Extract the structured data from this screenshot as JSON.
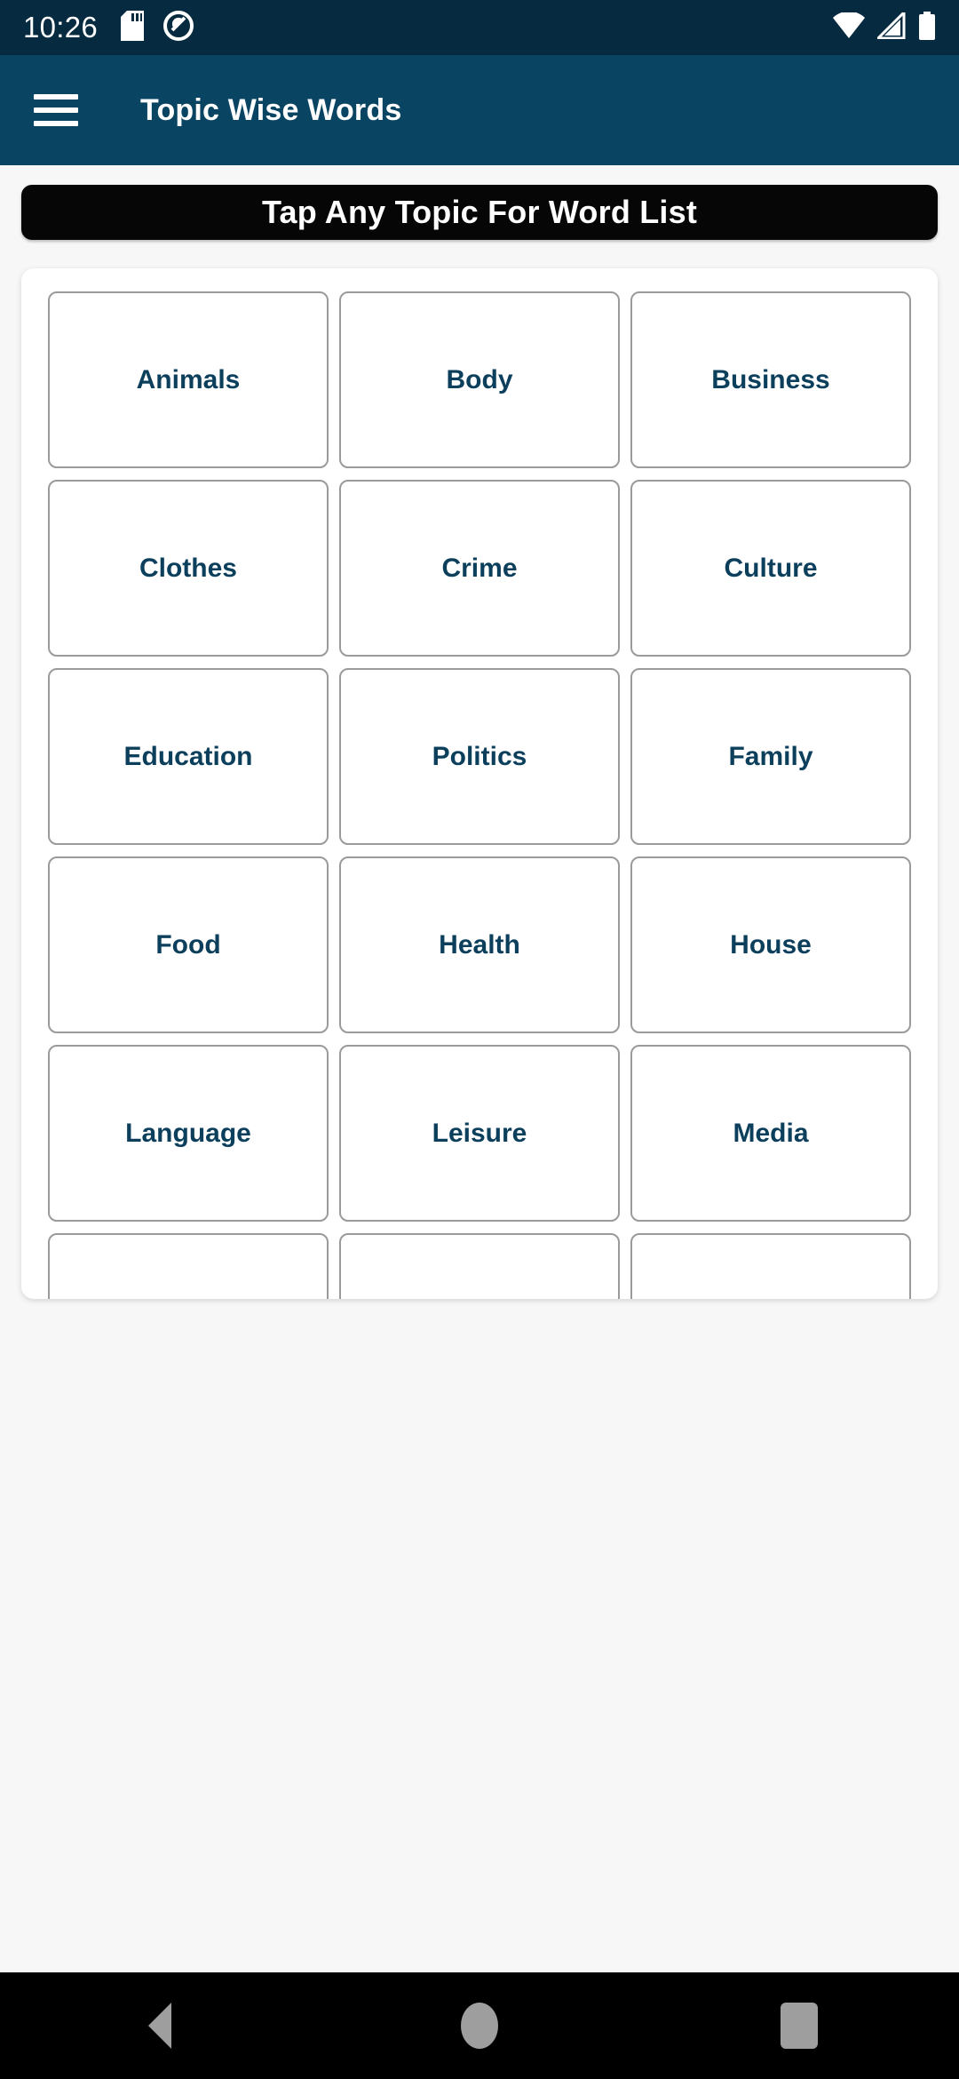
{
  "status_bar": {
    "time": "10:26",
    "left_icons": [
      "sd-card-icon",
      "do-not-disturb-icon"
    ],
    "right_icons": [
      "wifi-icon",
      "cellular-signal-icon",
      "battery-icon"
    ],
    "background_color": "#062b40"
  },
  "app_bar": {
    "menu_icon": "hamburger-menu-icon",
    "title": "Topic Wise Words",
    "background_color": "#0a4463"
  },
  "banner": {
    "text": "Tap Any Topic For Word List",
    "background_color": "#060606",
    "text_color": "#ffffff"
  },
  "topics_grid": {
    "columns": 3,
    "accent_color": "#0c3f5c",
    "border_color": "#9a9a9a",
    "items": [
      {
        "label": "Animals"
      },
      {
        "label": "Body"
      },
      {
        "label": "Business"
      },
      {
        "label": "Clothes"
      },
      {
        "label": "Crime"
      },
      {
        "label": "Culture"
      },
      {
        "label": "Education"
      },
      {
        "label": "Politics"
      },
      {
        "label": "Family"
      },
      {
        "label": "Food"
      },
      {
        "label": "Health"
      },
      {
        "label": "House"
      },
      {
        "label": "Language"
      },
      {
        "label": "Leisure"
      },
      {
        "label": "Media"
      },
      {
        "label": ""
      },
      {
        "label": ""
      },
      {
        "label": ""
      }
    ]
  },
  "nav_bar": {
    "background_color": "#000000",
    "buttons": [
      {
        "name": "back-button",
        "icon": "triangle-back-icon"
      },
      {
        "name": "home-button",
        "icon": "circle-home-icon"
      },
      {
        "name": "recents-button",
        "icon": "square-recents-icon"
      }
    ]
  }
}
